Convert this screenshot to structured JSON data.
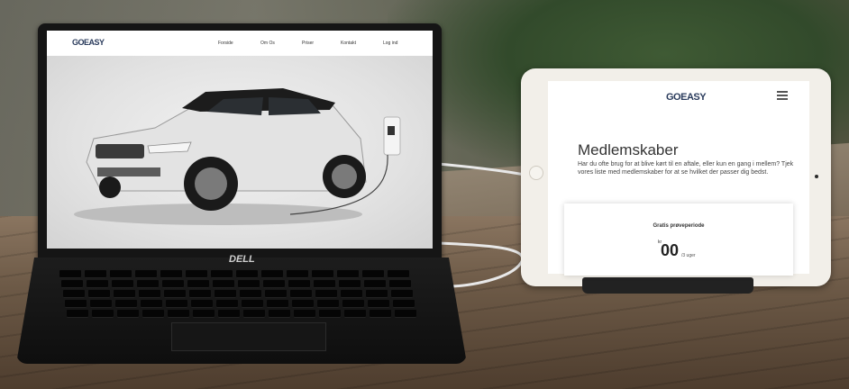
{
  "laptop": {
    "brand": "DELL",
    "site": {
      "logo": "GOEASY",
      "nav": [
        "Forside",
        "Om Os",
        "Priser",
        "Kontakt",
        "Log ind"
      ]
    }
  },
  "tablet": {
    "site": {
      "logo": "GOEASY",
      "heading": "Medlemskaber",
      "body": "Har du ofte brug for at blive kørt til en aftale, eller kun en gang i mellem? Tjek vores liste med medlemskaber for at se hvilket der passer dig bedst.",
      "card": {
        "title": "Gratis prøveperiode",
        "currency": "kr",
        "price": "00",
        "unit": "/3 uger"
      }
    }
  },
  "colors": {
    "logo": "#2a3b5c",
    "car": "#d9d9d9",
    "roof": "#1a1a1a"
  }
}
